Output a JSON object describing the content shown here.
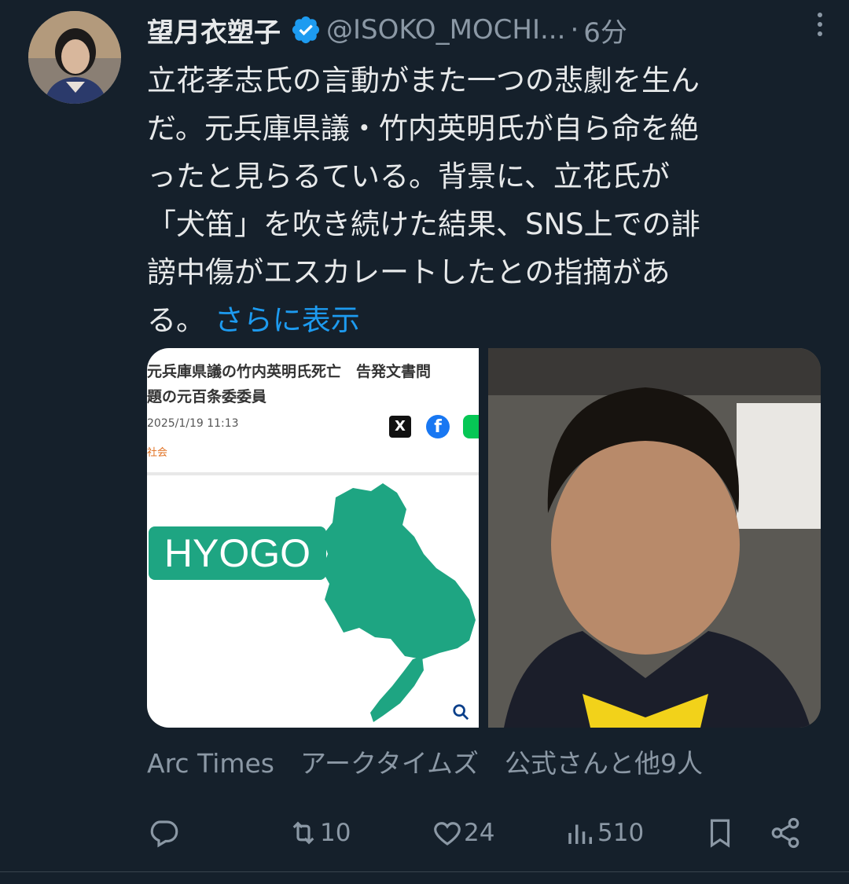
{
  "author": {
    "name": "望月衣塑子",
    "handle": "@ISOKO_MOCHI...",
    "separator": "·",
    "time": "6分"
  },
  "tweet": {
    "text": "立花孝志氏の言動がまた一つの悲劇を生んだ。元兵庫県議・竹内英明氏が自ら命を絶ったと見らるている。背景に、立花氏が「犬笛」を吹き続けた結果、SNS上での誹謗中傷がエスカレートしたとの指摘がある。",
    "lines": [
      "立花孝志氏の言動がまた一つの悲劇を生ん",
      "だ。元兵庫県議・竹内英明氏が自ら命を絶",
      "ったと見らるている。背景に、立花氏が",
      "「犬笛」を吹き続けた結果、SNS上での誹",
      "謗中傷がエスカレートしたとの指摘があ",
      "る。"
    ],
    "show_more": "さらに表示"
  },
  "media": {
    "article": {
      "title_line1": "元兵庫県議の竹内英明氏死亡　告発文書問",
      "title_line2": "題の元百条委委員",
      "date": "2025/1/19 11:13",
      "category": "社会",
      "map_label": "HYOGO",
      "map_color": "#1ea582"
    }
  },
  "attribution": "Arc Times　アークタイムズ　公式さんと他9人",
  "actions": {
    "reply": {
      "icon": "reply-icon",
      "count": ""
    },
    "retweet": {
      "icon": "retweet-icon",
      "count": "10"
    },
    "like": {
      "icon": "heart-icon",
      "count": "24"
    },
    "views": {
      "icon": "views-icon",
      "count": "510"
    },
    "bookmark": {
      "icon": "bookmark-icon"
    },
    "share": {
      "icon": "share-icon"
    }
  },
  "colors": {
    "background": "#15202b",
    "text": "#e7e9ea",
    "muted": "#8b98a5",
    "link": "#1d9bf0",
    "verified": "#1d9bf0"
  }
}
